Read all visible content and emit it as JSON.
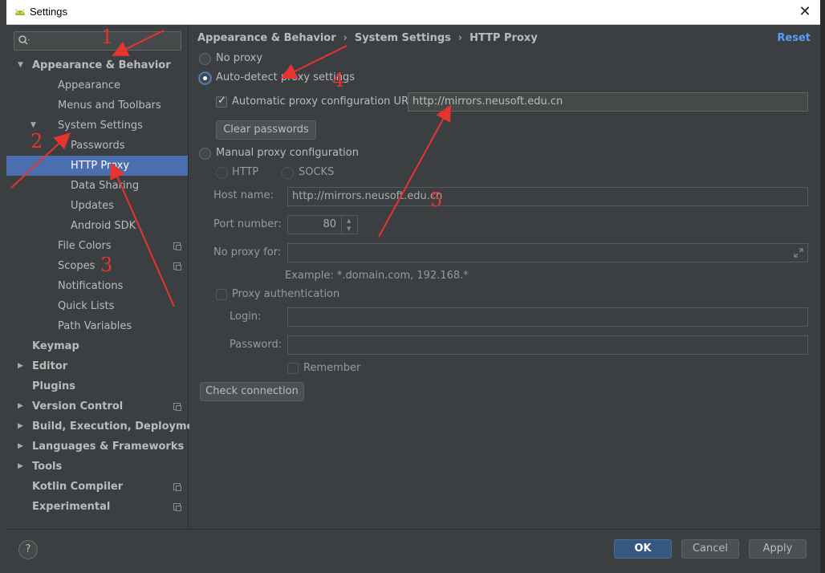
{
  "window": {
    "title": "Settings",
    "close_glyph": "✕"
  },
  "sidebar": {
    "search_placeholder": "",
    "items": [
      {
        "label": "Appearance & Behavior",
        "bold": true,
        "arrow": "▼"
      },
      {
        "label": "Appearance"
      },
      {
        "label": "Menus and Toolbars"
      },
      {
        "label": "System Settings",
        "arrow": "▼"
      },
      {
        "label": "Passwords"
      },
      {
        "label": "HTTP Proxy",
        "selected": true
      },
      {
        "label": "Data Sharing"
      },
      {
        "label": "Updates"
      },
      {
        "label": "Android SDK"
      },
      {
        "label": "File Colors",
        "copy_icon": true
      },
      {
        "label": "Scopes",
        "copy_icon": true
      },
      {
        "label": "Notifications"
      },
      {
        "label": "Quick Lists"
      },
      {
        "label": "Path Variables"
      },
      {
        "label": "Keymap",
        "bold": true
      },
      {
        "label": "Editor",
        "bold": true,
        "arrow": "▶"
      },
      {
        "label": "Plugins",
        "bold": true
      },
      {
        "label": "Version Control",
        "bold": true,
        "arrow": "▶",
        "copy_icon": true
      },
      {
        "label": "Build, Execution, Deployment",
        "bold": true,
        "arrow": "▶"
      },
      {
        "label": "Languages & Frameworks",
        "bold": true,
        "arrow": "▶"
      },
      {
        "label": "Tools",
        "bold": true,
        "arrow": "▶"
      },
      {
        "label": "Kotlin Compiler",
        "bold": true,
        "copy_icon": true
      },
      {
        "label": "Experimental",
        "bold": true,
        "copy_icon": true
      }
    ]
  },
  "breadcrumb": [
    "Appearance & Behavior",
    "System Settings",
    "HTTP Proxy"
  ],
  "breadcrumb_sep": "›",
  "reset_label": "Reset",
  "proxy": {
    "no_proxy": "No proxy",
    "auto_detect": "Auto-detect proxy settings",
    "auto_config_label": "Automatic proxy configuration URL:",
    "auto_config_url": "http://mirrors.neusoft.edu.cn",
    "clear_passwords": "Clear passwords",
    "manual": "Manual proxy configuration",
    "http": "HTTP",
    "socks": "SOCKS",
    "host_label": "Host name:",
    "host_value": "http://mirrors.neusoft.edu.cn",
    "port_label": "Port number:",
    "port_value": "80",
    "no_proxy_for_label": "No proxy for:",
    "no_proxy_for_value": "",
    "example": "Example: *.domain.com, 192.168.*",
    "proxy_auth": "Proxy authentication",
    "login_label": "Login:",
    "password_label": "Password:",
    "remember": "Remember",
    "check_connection": "Check connection"
  },
  "footer": {
    "help": "?",
    "ok": "OK",
    "cancel": "Cancel",
    "apply": "Apply"
  },
  "annotations": [
    "1",
    "2",
    "3",
    "4",
    "5"
  ],
  "colors": {
    "selection": "#4b6eaf",
    "link": "#589df6",
    "annotation": "#e8342e",
    "ok_button": "#365880"
  }
}
